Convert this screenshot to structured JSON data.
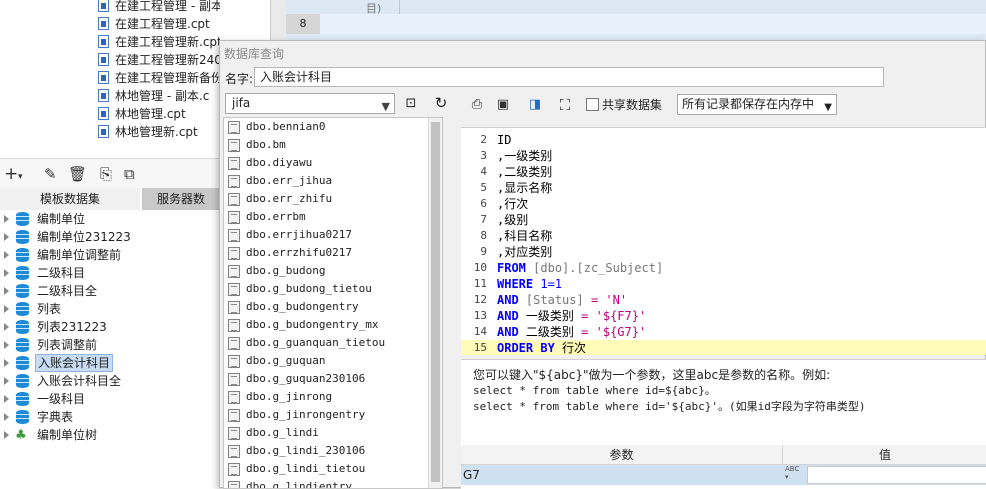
{
  "background": {
    "files": [
      "在建工程管理 - 副本.cpt",
      "在建工程管理.cpt",
      "在建工程管理新.cpt",
      "在建工程管理新240",
      "在建工程管理新备份",
      "林地管理 - 副本.c",
      "林地管理.cpt",
      "林地管理新.cpt"
    ],
    "grid_row_number": "8",
    "grid_partial_header": "目)"
  },
  "left_panel": {
    "tabs": {
      "dataset": "模板数据集",
      "server": "服务器数"
    },
    "datasets": [
      "编制单位",
      "编制单位231223",
      "编制单位调整前",
      "二级科目",
      "二级科目全",
      "列表",
      "列表231223",
      "列表调整前",
      "入账会计科目",
      "入账会计科目全",
      "一级科目",
      "字典表",
      "编制单位树"
    ],
    "selected_index": 8
  },
  "dialog": {
    "title": "数据库查询",
    "name_label": "名字:",
    "name_value": "入账会计科目",
    "connection": "jifa",
    "tables": [
      "dbo.bennian0",
      "dbo.bm",
      "dbo.diyawu",
      "dbo.err_jihua",
      "dbo.err_zhifu",
      "dbo.errbm",
      "dbo.errjihua0217",
      "dbo.errzhifu0217",
      "dbo.g_budong",
      "dbo.g_budong_tietou",
      "dbo.g_budongentry",
      "dbo.g_budongentry_mx",
      "dbo.g_guanquan_tietou",
      "dbo.g_guquan",
      "dbo.g_guquan230106",
      "dbo.g_jinrong",
      "dbo.g_jinrongentry",
      "dbo.g_lindi",
      "dbo.g_lindi_230106",
      "dbo.g_lindi_tietou",
      "dbo.g_lindientry"
    ],
    "share_dataset_label": "共享数据集",
    "storage_option": "所有记录都保存在内存中",
    "sql_lines": [
      {
        "n": "2",
        "text": "ID"
      },
      {
        "n": "3",
        "text": ",一级类别"
      },
      {
        "n": "4",
        "text": ",二级类别"
      },
      {
        "n": "5",
        "text": ",显示名称"
      },
      {
        "n": "6",
        "text": ",行次"
      },
      {
        "n": "7",
        "text": ",级别"
      },
      {
        "n": "8",
        "text": ",科目名称"
      },
      {
        "n": "9",
        "text": ",对应类别"
      },
      {
        "n": "10",
        "kw": "FROM",
        "rest": "[dbo].[zc_Subject]"
      },
      {
        "n": "11",
        "kw": "WHERE",
        "rest": "1=1"
      },
      {
        "n": "12",
        "kw": "AND",
        "rest_ident": "[Status]",
        "op": " = ",
        "str": "'N'"
      },
      {
        "n": "13",
        "kw": "AND",
        "rest_ident": "一级类别",
        "op": " = ",
        "str": "'${F7}'"
      },
      {
        "n": "14",
        "kw": "AND",
        "rest_ident": "二级类别",
        "op": " = ",
        "str": "'${G7}'"
      },
      {
        "n": "15",
        "kw": "ORDER BY",
        "rest_ident": "行次"
      }
    ],
    "hint_lines": [
      "您可以键入\"${abc}\"做为一个参数，这里abc是参数的名称。例如:",
      "select * from table where id=${abc}。",
      "select * from table where id='${abc}'。(如果id字段为字符串类型)"
    ],
    "param_headers": {
      "param": "参数",
      "value": "值"
    },
    "params": [
      {
        "name": "G7",
        "type_label": "ABC",
        "value": ""
      }
    ]
  }
}
